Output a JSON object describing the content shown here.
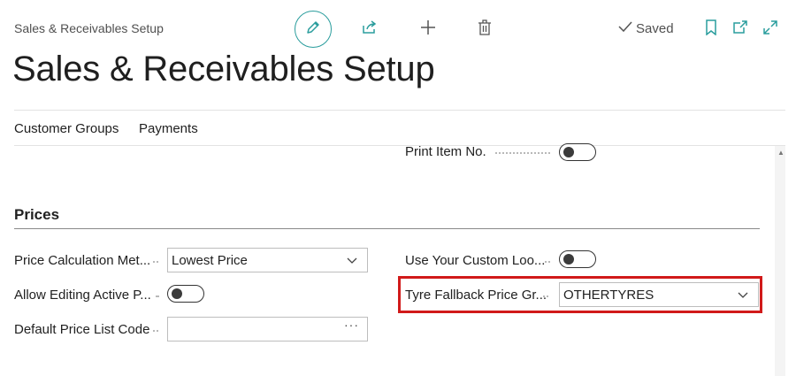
{
  "header": {
    "breadcrumb": "Sales & Receivables Setup",
    "title": "Sales & Receivables Setup",
    "status": "Saved"
  },
  "nav": {
    "items": [
      "Customer Groups",
      "Payments"
    ]
  },
  "fields": {
    "print_item_no": {
      "label": "Print Item No.",
      "value": false
    },
    "section_title": "Prices",
    "price_calc_method": {
      "label": "Price Calculation Met...",
      "value": "Lowest Price"
    },
    "allow_editing_active": {
      "label": "Allow Editing Active P...",
      "value": false
    },
    "default_price_list_code": {
      "label": "Default Price List Code",
      "value": ""
    },
    "use_custom_lookup": {
      "label": "Use Your Custom Loo...",
      "value": false
    },
    "tyre_fallback_price_group": {
      "label": "Tyre Fallback Price Gr...",
      "value": "OTHERTYRES"
    }
  },
  "icons": {
    "edit": "pencil-icon",
    "share": "share-icon",
    "new": "plus-icon",
    "delete": "trash-icon",
    "saved": "checkmark-icon",
    "bookmark": "bookmark-icon",
    "open_new": "open-new-window-icon",
    "expand": "expand-icon"
  },
  "colors": {
    "accent": "#2a9d9d",
    "highlight": "#d11a1a"
  }
}
